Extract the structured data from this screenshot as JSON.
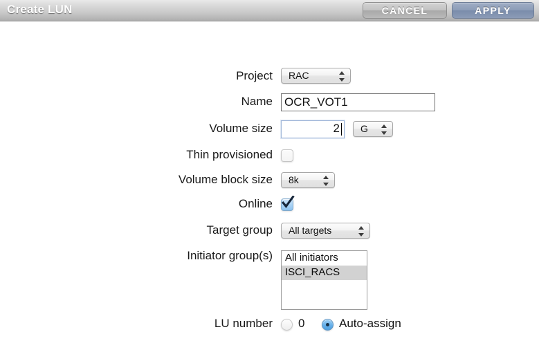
{
  "titlebar": {
    "title": "Create LUN",
    "cancel_label": "CANCEL",
    "apply_label": "APPLY",
    "apply_color": "#8d9db8",
    "cancel_color": "#c3c3c3"
  },
  "form": {
    "rows": [
      {
        "label": "Project",
        "type": "select",
        "value": "RAC"
      },
      {
        "label": "Name",
        "type": "text",
        "value": "OCR_VOT1"
      },
      {
        "label": "Volume size",
        "type": "text",
        "value": "2",
        "unit": "G"
      },
      {
        "label": "Thin provisioned",
        "type": "checkbox",
        "checked": false
      },
      {
        "label": "Volume block size",
        "type": "select",
        "value": "8k"
      },
      {
        "label": "Online",
        "type": "checkbox",
        "checked": true
      },
      {
        "label": "Target group",
        "type": "select",
        "value": "All targets"
      },
      {
        "label": "Initiator group(s)",
        "type": "listbox",
        "items": [
          "All initiators",
          "ISCI_RACS"
        ],
        "selected_index": 1
      },
      {
        "label": "LU number",
        "type": "radiogroup",
        "options": [
          {
            "label": "0",
            "selected": false
          },
          {
            "label": "Auto-assign",
            "selected": true
          }
        ]
      }
    ]
  },
  "labels": {
    "project": "Project",
    "name": "Name",
    "volume_size": "Volume size",
    "thin_provisioned": "Thin provisioned",
    "volume_block_size": "Volume block size",
    "online": "Online",
    "target_group": "Target group",
    "initiator_groups": "Initiator group(s)",
    "lu_number": "LU number"
  },
  "values": {
    "project": "RAC",
    "name": "OCR_VOT1",
    "volume_size": "2",
    "volume_size_unit": "G",
    "volume_block_size": "8k",
    "target_group": "All targets",
    "initiator_item_1": "All initiators",
    "initiator_item_2": "ISCI_RACS",
    "lu_zero": "0",
    "lu_auto": "Auto-assign"
  }
}
